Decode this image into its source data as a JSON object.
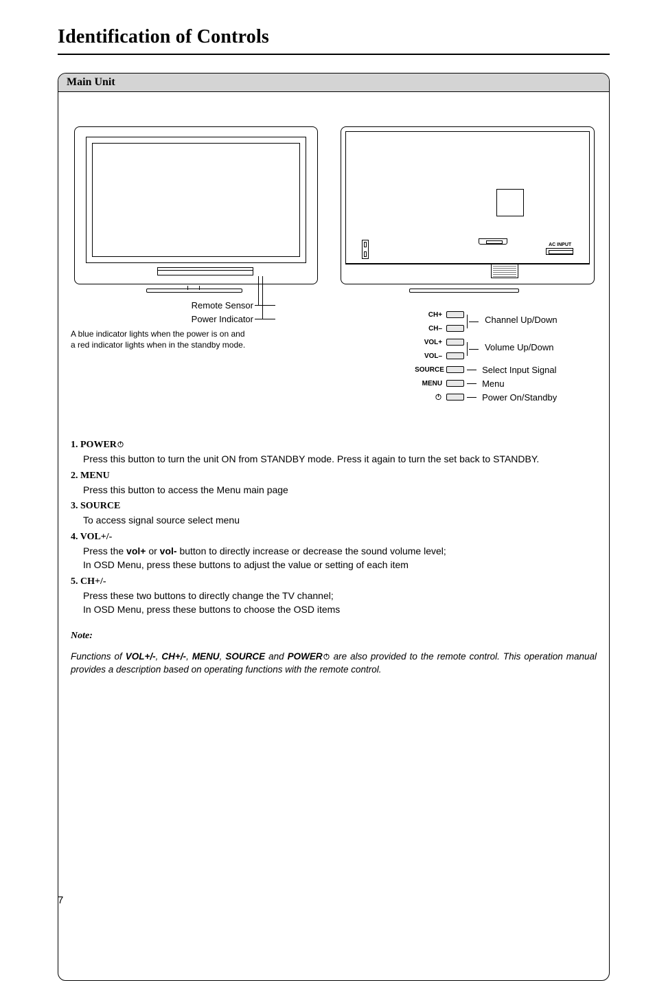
{
  "title": "Identification of Controls",
  "section_header": "Main Unit",
  "front": {
    "remote_sensor": "Remote Sensor",
    "power_indicator": "Power Indicator",
    "indicator_desc_1": "A blue indicator lights when the power is on and",
    "indicator_desc_2": "a red indicator lights when in the standby mode."
  },
  "back": {
    "ac_input": "AC INPUT",
    "rows": [
      {
        "left": "CH+",
        "right": "Channel Up/Down"
      },
      {
        "left": "CH–",
        "right": ""
      },
      {
        "left": "VOL+",
        "right": "Volume Up/Down"
      },
      {
        "left": "VOL–",
        "right": ""
      },
      {
        "left": "SOURCE",
        "right": "Select Input Signal"
      },
      {
        "left": "MENU",
        "right": "Menu"
      },
      {
        "left": "power-icon",
        "right": "Power On/Standby"
      }
    ]
  },
  "items": [
    {
      "num": "1.",
      "head": "POWER",
      "has_power_icon": true,
      "body": [
        "Press this button to turn the unit ON from STANDBY mode. Press it again to turn the set back to STANDBY."
      ]
    },
    {
      "num": "2.",
      "head": "MENU",
      "body": [
        "Press this button to access the Menu main page"
      ]
    },
    {
      "num": "3.",
      "head": "SOURCE",
      "body": [
        "To access signal source select menu"
      ]
    },
    {
      "num": "4.",
      "head": "VOL+/-",
      "body": [
        "Press the <b>vol+</b> or <b>vol-</b> button to directly increase or decrease the sound volume level;",
        "In OSD Menu, press these buttons to adjust the value or setting of each item"
      ]
    },
    {
      "num": "5.",
      "head": "CH+/-",
      "body": [
        "Press these two buttons to directly change the TV channel;",
        "In OSD Menu, press these buttons to choose the OSD items"
      ]
    }
  ],
  "note": {
    "head": "Note:",
    "body_pre": "Functions of ",
    "body_bold": [
      "VOL+/-",
      "CH+/-",
      "MENU",
      "SOURCE",
      "POWER"
    ],
    "body_mid": " and ",
    "body_post": " are also provided to the remote control. This operation manual provides a description based on operating functions with the remote control."
  },
  "page_number": "7"
}
